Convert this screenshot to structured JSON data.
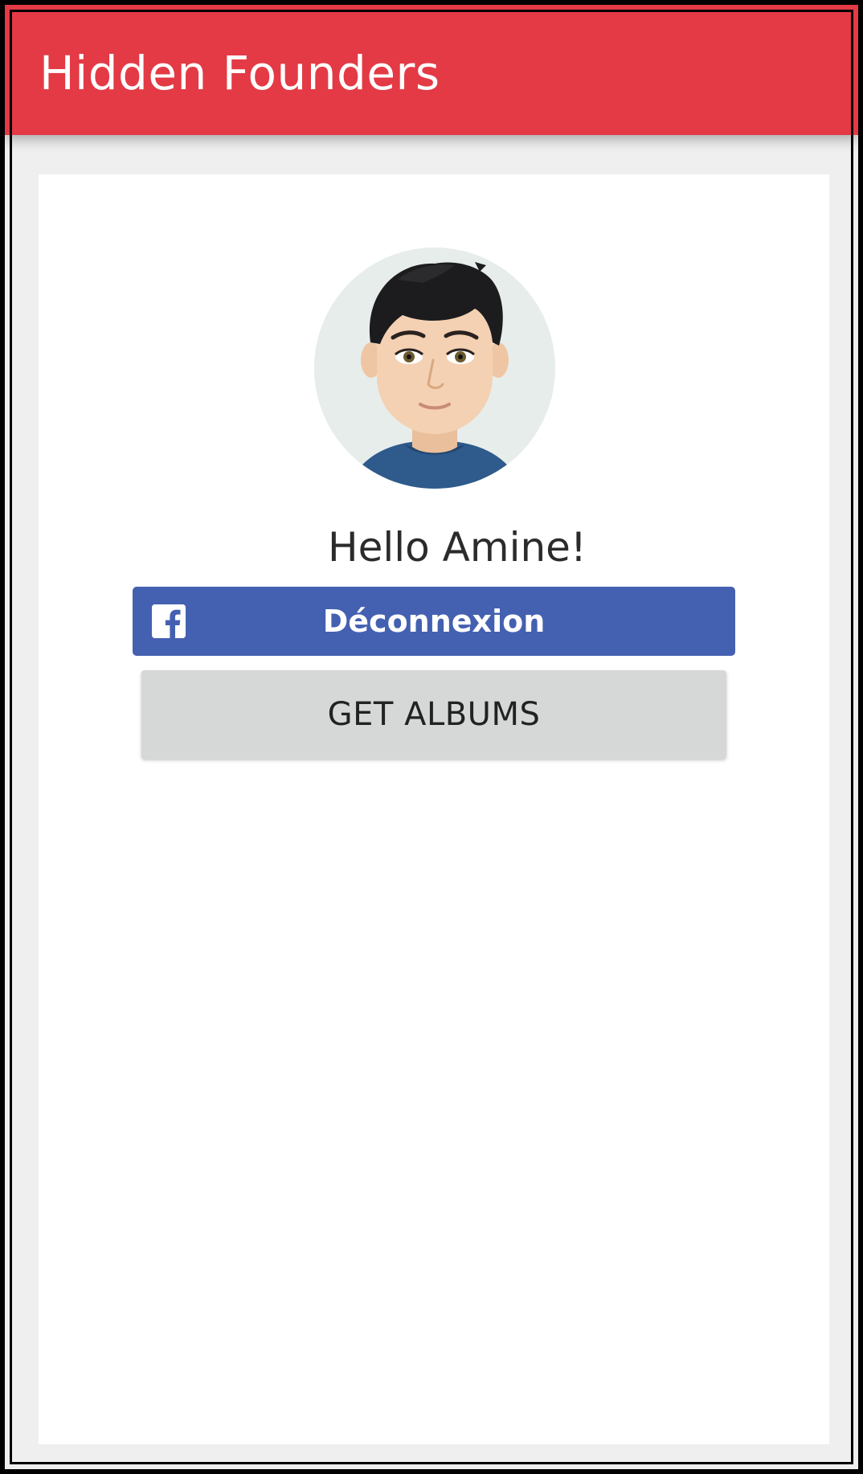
{
  "app_bar": {
    "title": "Hidden Founders",
    "color": "#e33a45"
  },
  "profile": {
    "avatar_icon": "user-avatar-cartoon",
    "greeting": "Hello Amine!"
  },
  "buttons": {
    "facebook": {
      "icon": "facebook-icon",
      "label": "Déconnexion",
      "color": "#4460b0"
    },
    "get_albums": {
      "label": "GET ALBUMS",
      "color": "#d6d7d7"
    }
  }
}
